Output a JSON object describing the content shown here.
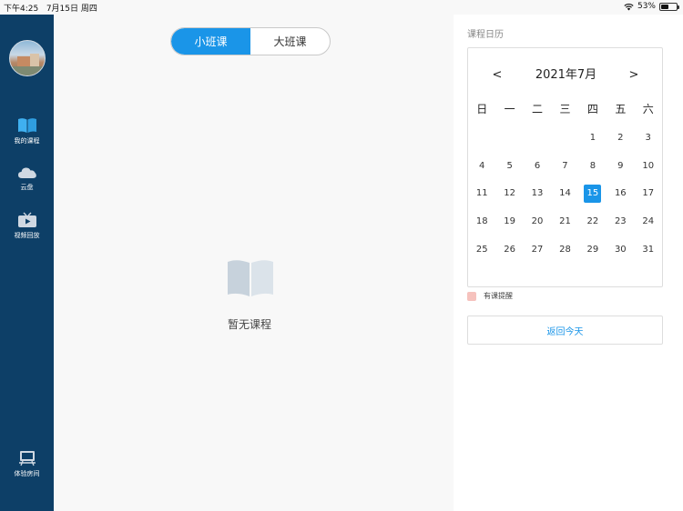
{
  "status_bar": {
    "time": "下午4:25",
    "date": "7月15日 周四",
    "battery": "53%",
    "battery_level": 0.53,
    "wifi_icon": "wifi-icon"
  },
  "sidebar": {
    "avatar_icon": "avatar",
    "items": [
      {
        "label": "我的课程",
        "icon": "book-icon"
      },
      {
        "label": "云盘",
        "icon": "cloud-icon"
      },
      {
        "label": "视频回放",
        "icon": "tv-icon"
      },
      {
        "label": "体验房间",
        "icon": "classroom-icon"
      }
    ]
  },
  "main": {
    "tabs": [
      {
        "label": "小班课",
        "active": true
      },
      {
        "label": "大班课",
        "active": false
      }
    ],
    "empty_text": "暂无课程",
    "empty_icon": "open-book-icon"
  },
  "calendar": {
    "title": "课程日历",
    "month_label": "2021年7月",
    "prev_label": "<",
    "next_label": ">",
    "weekdays": [
      "日",
      "一",
      "二",
      "三",
      "四",
      "五",
      "六"
    ],
    "weeks": [
      [
        "",
        "",
        "",
        "",
        "1",
        "2",
        "3"
      ],
      [
        "4",
        "5",
        "6",
        "7",
        "8",
        "9",
        "10"
      ],
      [
        "11",
        "12",
        "13",
        "14",
        "15",
        "16",
        "17"
      ],
      [
        "18",
        "19",
        "20",
        "21",
        "22",
        "23",
        "24"
      ],
      [
        "25",
        "26",
        "27",
        "28",
        "29",
        "30",
        "31"
      ]
    ],
    "today": "15",
    "legend_label": "有课提醒",
    "back_today_label": "返回今天"
  },
  "colors": {
    "sidebar_bg": "#0d3f67",
    "accent": "#1a95e8",
    "legend": "#f6c2bd"
  }
}
